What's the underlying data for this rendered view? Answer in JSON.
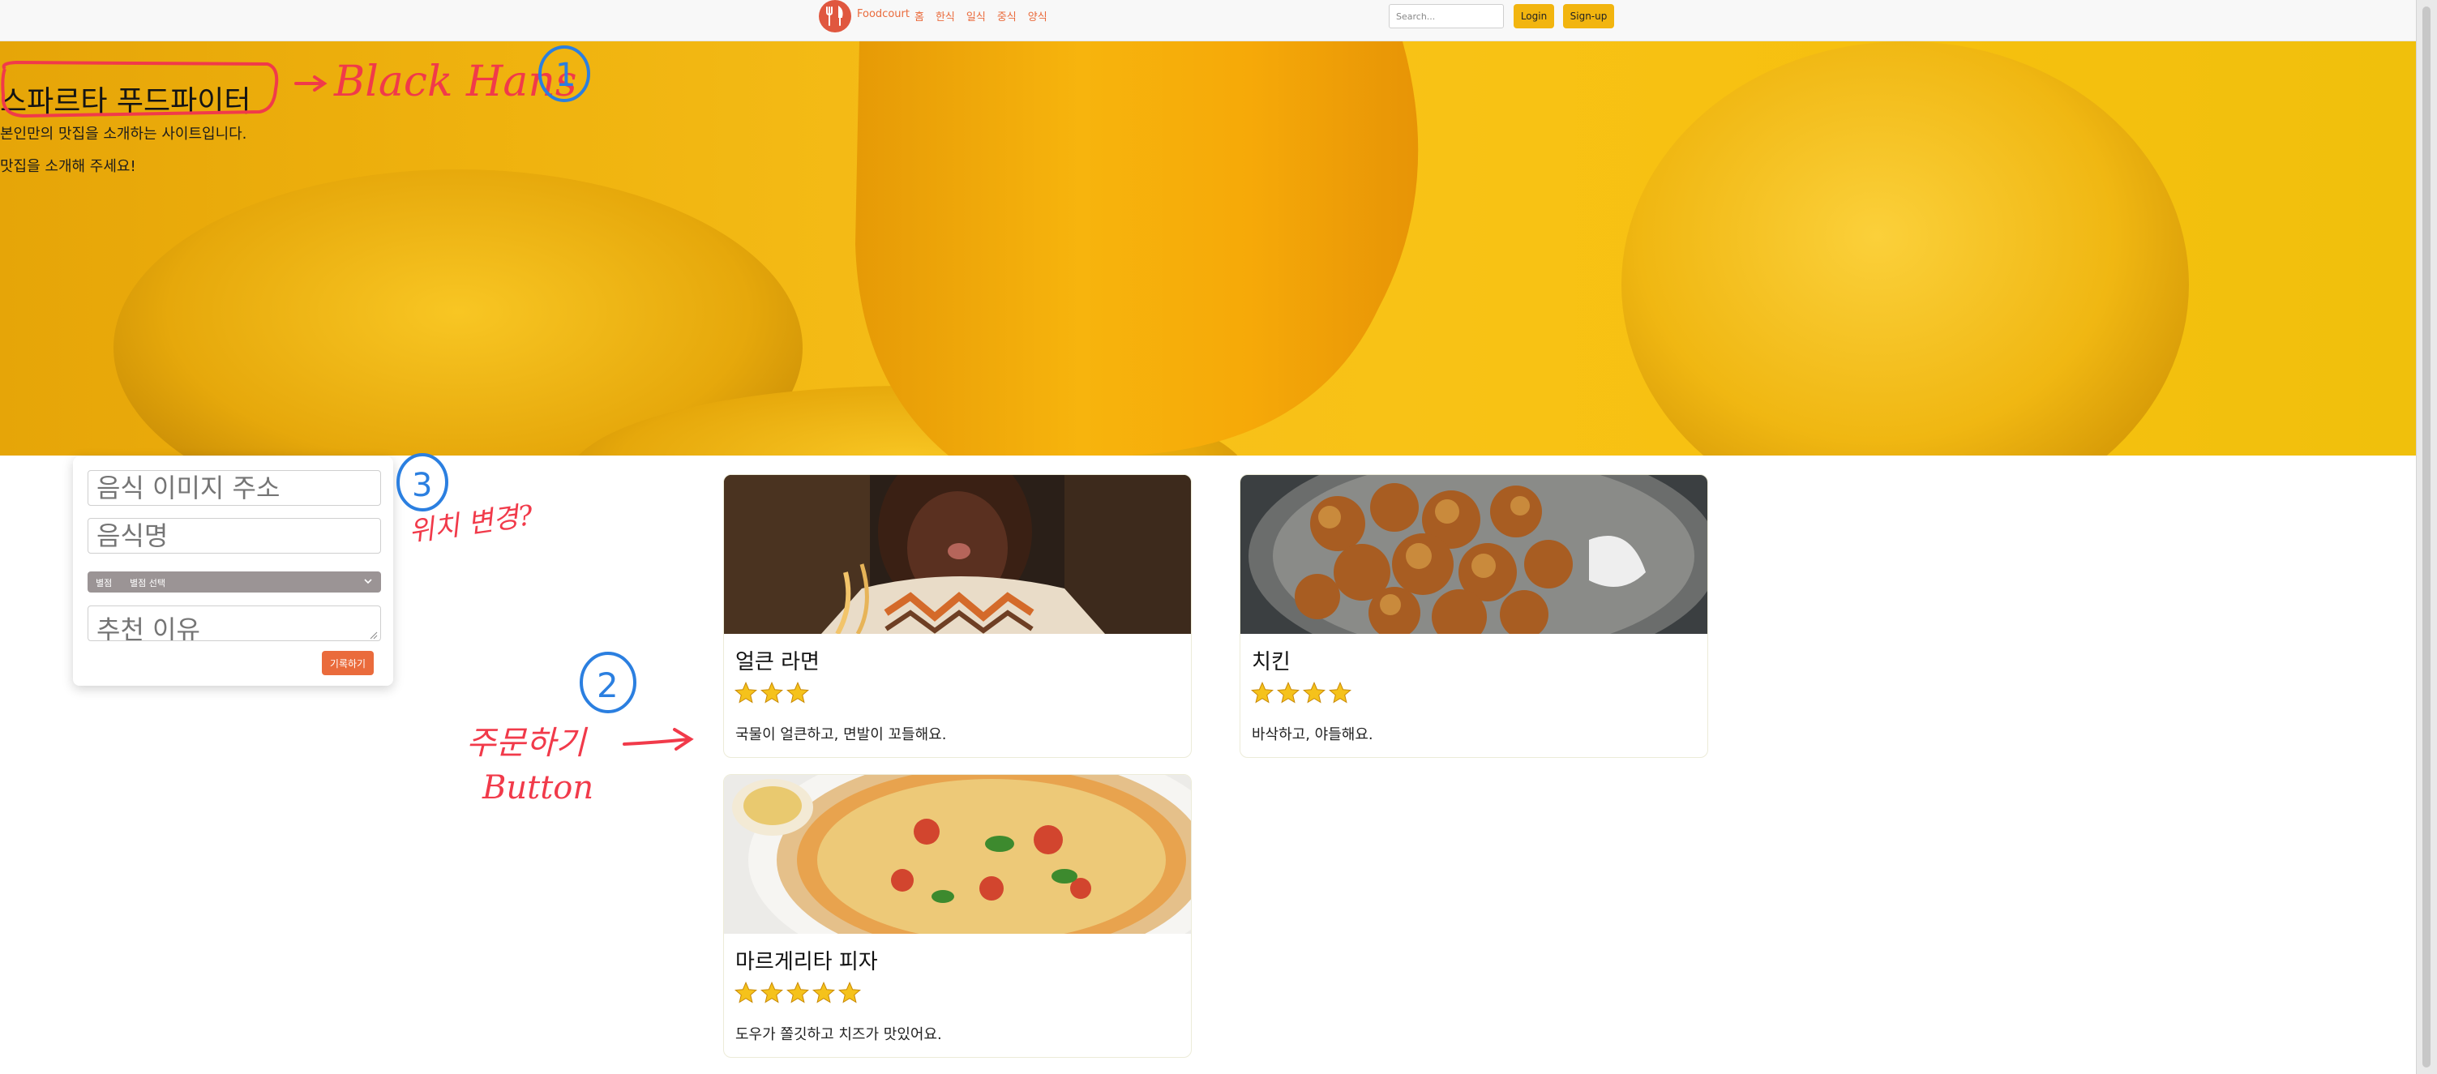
{
  "navbar": {
    "brand": "Foodcourt",
    "links": [
      "홈",
      "한식",
      "일식",
      "중식",
      "양식"
    ],
    "search_placeholder": "Search...",
    "login_label": "Login",
    "signup_label": "Sign-up"
  },
  "hero": {
    "title": "스파르타 푸드파이터",
    "subtitle": "본인만의 맛집을 소개하는 사이트입니다.",
    "cta": "맛집을 소개해 주세요!"
  },
  "annotations": {
    "note_1": "Black Hans",
    "marker_1": "1",
    "note_2_line1": "주문하기",
    "note_2_line2": "Button",
    "marker_2": "2",
    "note_3": "위치 변경?",
    "marker_3": "3",
    "colors": {
      "red": "#f13a4a",
      "blue": "#2b7fe0"
    }
  },
  "form": {
    "image_url_placeholder": "음식 이미지 주소",
    "food_name_placeholder": "음식명",
    "rating_label": "별점",
    "rating_selected": "별점 선택",
    "reason_placeholder": "추천 이유",
    "submit_label": "기록하기"
  },
  "cards": [
    {
      "title": "얼큰 라면",
      "rating": 3,
      "description": "국물이 얼큰하고, 면발이 꼬들해요."
    },
    {
      "title": "치킨",
      "rating": 4,
      "description": "바삭하고, 야들해요."
    },
    {
      "title": "마르게리타 피자",
      "rating": 5,
      "description": "도우가 쫄깃하고 치즈가 맛있어요."
    }
  ],
  "colors": {
    "accent": "#ea6b3c",
    "button_yellow": "#f2b50f",
    "hero_yellow": "#f7c01a",
    "star": "#f5c21b"
  }
}
